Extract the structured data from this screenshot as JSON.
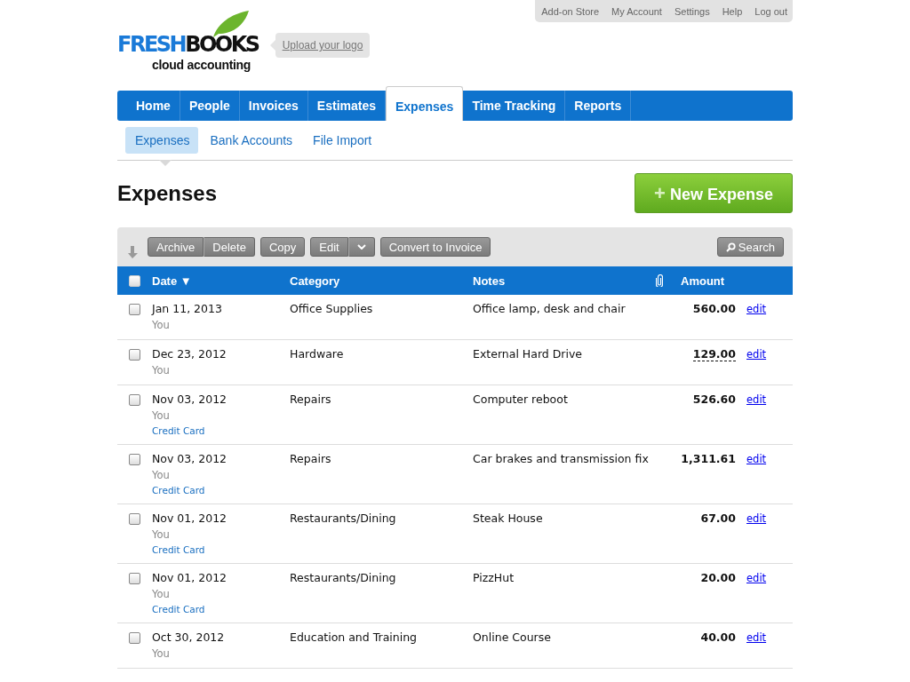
{
  "top_links": [
    "Add-on Store",
    "My Account",
    "Settings",
    "Help",
    "Log out"
  ],
  "logo": {
    "first": "FRESH",
    "second": "BOOKS",
    "tagline": "cloud accounting"
  },
  "upload_logo": "Upload your logo",
  "nav_tabs": [
    {
      "label": "Home",
      "selected": false
    },
    {
      "label": "People",
      "selected": false
    },
    {
      "label": "Invoices",
      "selected": false
    },
    {
      "label": "Estimates",
      "selected": false
    },
    {
      "label": "Expenses",
      "selected": true
    },
    {
      "label": "Time Tracking",
      "selected": false
    },
    {
      "label": "Reports",
      "selected": false
    }
  ],
  "sub_tabs": [
    {
      "label": "Expenses",
      "selected": true
    },
    {
      "label": "Bank Accounts",
      "selected": false
    },
    {
      "label": "File Import",
      "selected": false
    }
  ],
  "page_title": "Expenses",
  "new_button": {
    "icon": "+",
    "label": "New Expense"
  },
  "toolbar": {
    "groups": [
      [
        "Archive",
        "Delete"
      ],
      [
        "Copy"
      ],
      [
        "Edit"
      ],
      [
        "Convert to Invoice"
      ]
    ],
    "search": "Search"
  },
  "table": {
    "all_checked": false,
    "columns": [
      "Date",
      "Category",
      "Notes",
      "Amount"
    ],
    "sort_mark": "▼",
    "rows": [
      {
        "date": "Jan 11, 2013",
        "by": "You",
        "category": "Office Supplies",
        "notes": "Office lamp, desk and chair",
        "amount": "560.00",
        "underlined": false,
        "edit": "edit",
        "checked": false
      },
      {
        "date": "Dec 23, 2012",
        "by": "You",
        "category": "Hardware",
        "notes": "External Hard Drive",
        "amount": "129.00",
        "underlined": true,
        "edit": "edit",
        "checked": false
      },
      {
        "date": "Nov 03, 2012",
        "by": "You",
        "source": "Credit Card",
        "category": "Repairs",
        "notes": "Computer reboot",
        "amount": "526.60",
        "underlined": false,
        "edit": "edit",
        "checked": false
      },
      {
        "date": "Nov 03, 2012",
        "by": "You",
        "source": "Credit Card",
        "category": "Repairs",
        "notes": "Car brakes and transmission fix",
        "amount": "1,311.61",
        "underlined": false,
        "edit": "edit",
        "checked": false
      },
      {
        "date": "Nov 01, 2012",
        "by": "You",
        "source": "Credit Card",
        "category": "Restaurants/Dining",
        "notes": "Steak House",
        "amount": "67.00",
        "underlined": false,
        "edit": "edit",
        "checked": false
      },
      {
        "date": "Nov 01, 2012",
        "by": "You",
        "source": "Credit Card",
        "category": "Restaurants/Dining",
        "notes": "PizzHut",
        "amount": "20.00",
        "underlined": false,
        "edit": "edit",
        "checked": false
      },
      {
        "date": "Oct 30, 2012",
        "by": "You",
        "category": "Education and Training",
        "notes": "Online Course",
        "amount": "40.00",
        "underlined": false,
        "edit": "edit",
        "checked": false
      }
    ]
  }
}
